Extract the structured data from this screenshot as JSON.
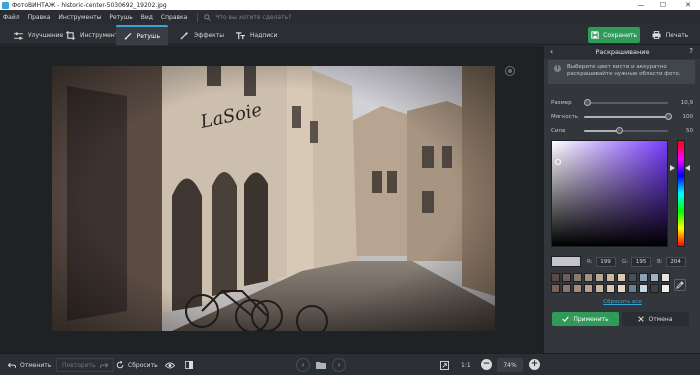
{
  "window": {
    "title": "ФотоВИНТАЖ - historic-center-5030692_19202.jpg",
    "minimize_glyph": "—",
    "maximize_glyph": "☐",
    "close_glyph": "✕"
  },
  "menu": {
    "items": [
      "Файл",
      "Правка",
      "Инструменты",
      "Ретушь",
      "Вид",
      "Справка"
    ],
    "search_placeholder": "Что вы хотите сделать?"
  },
  "toolbar": {
    "tabs": [
      {
        "label": "Улучшение",
        "icon": "sliders-icon"
      },
      {
        "label": "Инструменты",
        "icon": "crop-icon"
      },
      {
        "label": "Ретушь",
        "icon": "brush-icon",
        "active": true
      },
      {
        "label": "Эффекты",
        "icon": "magic-wand-icon"
      },
      {
        "label": "Надписи",
        "icon": "text-icon"
      }
    ],
    "save_label": "Сохранить",
    "print_label": "Печать"
  },
  "bottom": {
    "undo_label": "Отменить",
    "redo_label": "Повторить",
    "reset_label": "Сбросить",
    "ratio_label": "1:1",
    "zoom_value": "74%",
    "zoom_out_glyph": "−",
    "zoom_in_glyph": "+",
    "prev_glyph": "‹",
    "next_glyph": "›"
  },
  "panel": {
    "title": "Раскрашивание",
    "back_glyph": "‹",
    "help_glyph": "?",
    "hint_glyph": "i",
    "hint": "Выберите цвет кисти и аккуратно раскрашивайте нужные области фото.",
    "sliders": [
      {
        "label": "Размер",
        "value": "10,9",
        "level": 0.04
      },
      {
        "label": "Мягкость",
        "value": "100",
        "level": 1.0
      },
      {
        "label": "Сила",
        "value": "50",
        "level": 0.42
      }
    ],
    "color": {
      "current_hex": "#c7c3cc",
      "r_label": "R:",
      "r": "199",
      "g_label": "G:",
      "g": "195",
      "b_label": "B:",
      "b": "204"
    },
    "swatches": [
      "#5a4a44",
      "#6d5e57",
      "#8a7a6e",
      "#a38f80",
      "#b9a693",
      "#c9b8a2",
      "#d7cab5",
      "#4c4f56",
      "#8fa1b7",
      "#9fb3c4",
      "#e8e4dc",
      "#7b6258",
      "#8e7568",
      "#a58c7d",
      "#b89f8d",
      "#cbb4a0",
      "#d9c6b2",
      "#e6d8c6",
      "#6b7f96",
      "#c9d7e5",
      "#3d4148",
      "#f1eee8"
    ],
    "reset_all_label": "Сбросить все",
    "apply_label": "Применить",
    "cancel_label": "Отмена"
  }
}
